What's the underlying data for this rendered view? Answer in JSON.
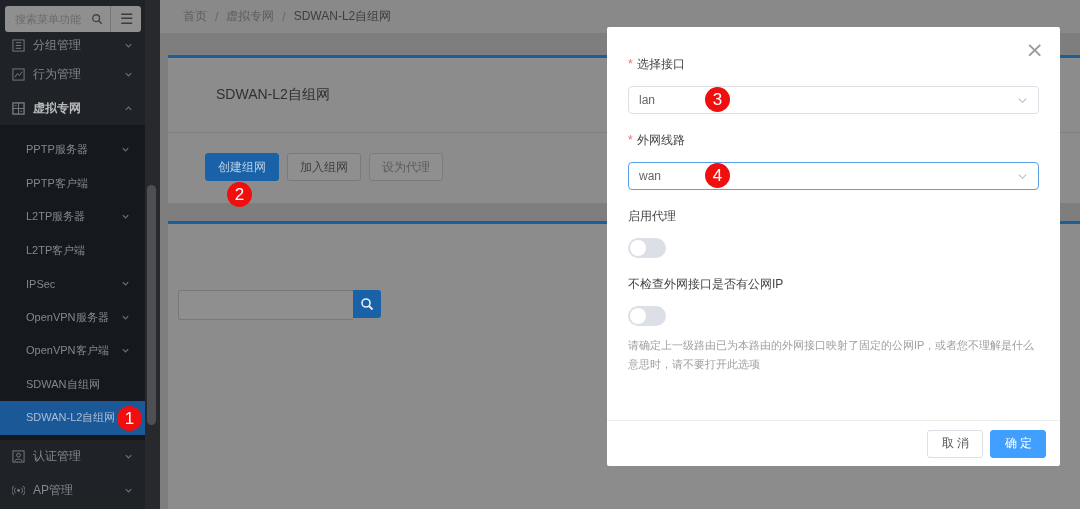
{
  "sidebar": {
    "search": {
      "placeholder": "搜索菜单功能"
    },
    "menu_button": "☰",
    "items": [
      {
        "label": "分组管理",
        "expanded": false
      },
      {
        "label": "行为管理",
        "expanded": false
      },
      {
        "label": "虚拟专网",
        "expanded": true,
        "children": [
          {
            "label": "PPTP服务器",
            "kind": "group",
            "selected": false
          },
          {
            "label": "PPTP客户端",
            "kind": "link",
            "selected": false
          },
          {
            "label": "L2TP服务器",
            "kind": "group",
            "selected": false
          },
          {
            "label": "L2TP客户端",
            "kind": "link",
            "selected": false
          },
          {
            "label": "IPSec",
            "kind": "group",
            "selected": false
          },
          {
            "label": "OpenVPN服务器",
            "kind": "group",
            "selected": false
          },
          {
            "label": "OpenVPN客户端",
            "kind": "group",
            "selected": false
          },
          {
            "label": "SDWAN自组网",
            "kind": "link",
            "selected": false
          },
          {
            "label": "SDWAN-L2自组网",
            "kind": "link",
            "selected": true,
            "marker": "1"
          }
        ]
      },
      {
        "label": "认证管理",
        "expanded": false
      },
      {
        "label": "AP管理",
        "expanded": false
      }
    ]
  },
  "breadcrumb": {
    "separator": "/",
    "items": [
      "首页",
      "虚拟专网",
      "SDWAN-L2自组网"
    ]
  },
  "card": {
    "title": "SDWAN-L2自组网",
    "buttons": [
      {
        "label": "创建组网",
        "kind": "primary",
        "disabled": false,
        "marker": "2"
      },
      {
        "label": "加入组网",
        "kind": "default",
        "disabled": false
      },
      {
        "label": "设为代理",
        "kind": "default",
        "disabled": true
      }
    ]
  },
  "dialog": {
    "close": "×",
    "fields": [
      {
        "kind": "select",
        "label": "选择接口",
        "required_mark": "*",
        "value": "lan",
        "focused": false,
        "marker": "3"
      },
      {
        "kind": "select",
        "label": "外网线路",
        "required_mark": "*",
        "value": "wan",
        "focused": true,
        "marker": "4"
      },
      {
        "kind": "switch",
        "label": "启用代理",
        "on": false
      },
      {
        "kind": "switch",
        "label": "不检查外网接口是否有公网IP",
        "on": false,
        "help": "请确定上一级路由已为本路由的外网接口映射了固定的公网IP，或者您不理解是什么意思时，请不要打开此选项"
      }
    ],
    "buttons": [
      {
        "label": "取消",
        "kind": "default"
      },
      {
        "label": "确定",
        "kind": "primary"
      }
    ]
  }
}
